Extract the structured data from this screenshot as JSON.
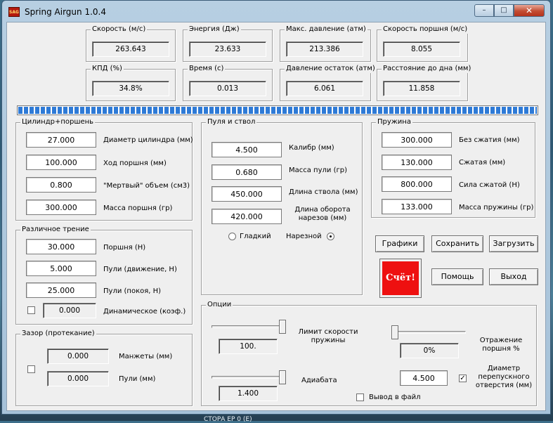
{
  "window": {
    "title": "Spring Airgun    1.0.4",
    "logo_text": "SAG",
    "min_glyph": "–",
    "max_glyph": "□",
    "close_glyph": "✕"
  },
  "results": [
    {
      "label": "Скорость (м/с)",
      "value": "263.643"
    },
    {
      "label": "Энергия (Дж)",
      "value": "23.633"
    },
    {
      "label": "Макс. давление (атм)",
      "value": "213.386"
    },
    {
      "label": "Скорость поршня (м/с)",
      "value": "8.055"
    },
    {
      "label": "КПД (%)",
      "value": "34.8%"
    },
    {
      "label": "Время (с)",
      "value": "0.013"
    },
    {
      "label": "Давление остаток (атм)",
      "value": "6.061"
    },
    {
      "label": "Расстояние до дна (мм)",
      "value": "11.858"
    }
  ],
  "progress": {
    "fraction": 1.0
  },
  "cylinder": {
    "title": "Цилиндр+поршень",
    "fields": [
      {
        "value": "27.000",
        "label": "Диаметр цилиндра (мм)"
      },
      {
        "value": "100.000",
        "label": "Ход поршня (мм)"
      },
      {
        "value": "0.800",
        "label": "\"Мертвый\" объем (см3)"
      },
      {
        "value": "300.000",
        "label": "Масса поршня (гр)"
      }
    ]
  },
  "friction": {
    "title": "Различное трение",
    "fields": [
      {
        "value": "30.000",
        "label": "Поршня (Н)"
      },
      {
        "value": "5.000",
        "label": "Пули (движение, Н)"
      },
      {
        "value": "25.000",
        "label": "Пули (покоя, Н)"
      }
    ],
    "dynamic": {
      "value": "0.000",
      "label": "Динамическое (коэф.)",
      "checked": false
    }
  },
  "gap": {
    "title": "Зазор (протекание)",
    "cuffs": {
      "value": "0.000",
      "label": "Манжеты (мм)"
    },
    "bullet": {
      "value": "0.000",
      "label": "Пули (мм)"
    },
    "checked": false
  },
  "barrel": {
    "title": "Пуля и ствол",
    "fields": [
      {
        "value": "4.500",
        "label": "Калибр (мм)"
      },
      {
        "value": "0.680",
        "label": "Масса пули (гр)"
      },
      {
        "value": "450.000",
        "label": "Длина ствола (мм)"
      },
      {
        "value": "420.000",
        "label": "Длина оборота нарезов (мм)"
      }
    ],
    "smooth_label": "Гладкий",
    "rifled_label": "Нарезной",
    "selected": "rifled"
  },
  "spring": {
    "title": "Пружина",
    "fields": [
      {
        "value": "300.000",
        "label": "Без  сжатия (мм)"
      },
      {
        "value": "130.000",
        "label": "Сжатая (мм)"
      },
      {
        "value": "800.000",
        "label": "Сила сжатой (Н)"
      },
      {
        "value": "133.000",
        "label": "Масса пружины (гр)"
      }
    ]
  },
  "buttons": {
    "graphs": "Графики",
    "save": "Сохранить",
    "load": "Загрузить",
    "calc": "Счёт!",
    "help": "Помощь",
    "exit": "Выход"
  },
  "options": {
    "title": "Опции",
    "spring_speed_limit": {
      "label": "Лимит скорости пружины",
      "value": "100.",
      "slider_fraction": 1.0
    },
    "adiabat": {
      "label": "Адиабата",
      "value": "1.400",
      "slider_fraction": 1.0
    },
    "piston_reflection": {
      "label": "Отражение поршня %",
      "value": "0%",
      "slider_fraction": 0.0
    },
    "bypass_diameter": {
      "label": "Диаметр перепускного отверстия (мм)",
      "value": "4.500",
      "checked": true
    },
    "file_output": {
      "label": "Вывод в файл",
      "checked": false
    }
  },
  "taskbar": {
    "text": "СТОРА ЕР 0 (Е)"
  }
}
